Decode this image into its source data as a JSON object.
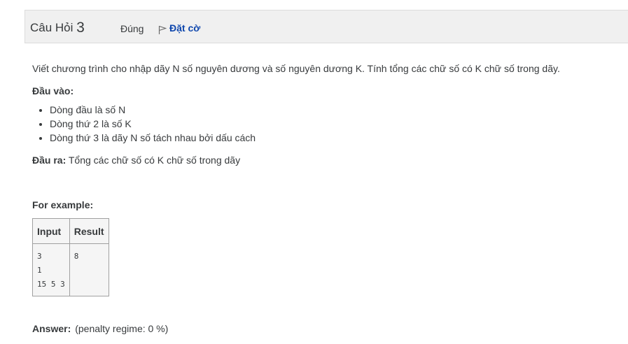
{
  "question": {
    "label": "Câu Hỏi",
    "number": "3",
    "state": "Đúng",
    "flag_label": "Đặt cờ"
  },
  "problem": {
    "intro": "Viết chương trình cho nhập dãy N số nguyên dương và số nguyên dương K. Tính tổng các chữ số có K chữ số trong dãy.",
    "input_label": "Đầu vào:",
    "input_items": [
      "Dòng đầu là số N",
      "Dòng thứ 2 là số K",
      "Dòng thứ 3 là dãy N số tách nhau bởi dấu cách"
    ],
    "output_label": "Đầu ra:",
    "output_text": " Tổng các chữ số có K chữ số trong dãy"
  },
  "example": {
    "title": "For example:",
    "headers": [
      "Input",
      "Result"
    ],
    "input": "3\n1\n15 5 3",
    "result": "8"
  },
  "answer": {
    "label": "Answer:",
    "penalty": "(penalty regime: 0 %)"
  }
}
